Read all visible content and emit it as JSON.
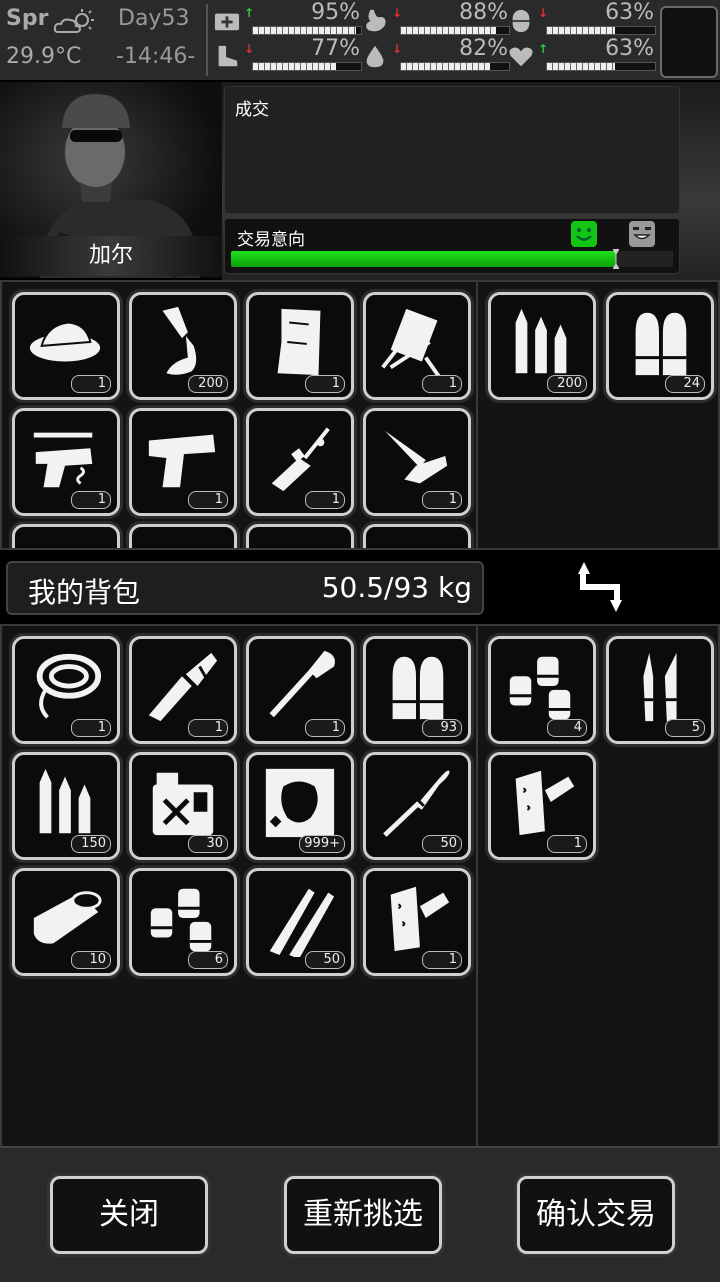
{
  "status": {
    "season": "Spr",
    "temperature": "29.9°C",
    "day": "Day53",
    "time": "-14:46-",
    "stats": [
      {
        "icon": "medkit-icon",
        "trend": "up",
        "value": "95%",
        "level": 0.95
      },
      {
        "icon": "stomach-icon",
        "trend": "down",
        "value": "88%",
        "level": 0.88
      },
      {
        "icon": "stamina-pill-icon",
        "trend": "down",
        "value": "63%",
        "level": 0.63
      },
      {
        "icon": "boot-icon",
        "trend": "down",
        "value": "77%",
        "level": 0.77
      },
      {
        "icon": "water-drop-icon",
        "trend": "down",
        "value": "82%",
        "level": 0.82
      },
      {
        "icon": "heart-icon",
        "trend": "up",
        "value": "63%",
        "level": 0.63
      }
    ]
  },
  "trader": {
    "name": "加尔",
    "dialog": "成交",
    "intent_label": "交易意向",
    "intent_level": 0.87
  },
  "trader_items": [
    {
      "icon": "dish-helmet-icon",
      "qty": "1"
    },
    {
      "icon": "glue-tube-icon",
      "qty": "200"
    },
    {
      "icon": "cloth-scrap-icon",
      "qty": "1"
    },
    {
      "icon": "folding-chair-icon",
      "qty": "1"
    },
    {
      "icon": "pistol-parts-icon",
      "qty": "1"
    },
    {
      "icon": "desert-eagle-icon",
      "qty": "1"
    },
    {
      "icon": "rifle-parts-icon",
      "qty": "1"
    },
    {
      "icon": "folding-knife-icon",
      "qty": "1"
    }
  ],
  "trader_offer": [
    {
      "icon": "rifle-ammo-icon",
      "qty": "200"
    },
    {
      "icon": "pistol-ammo-icon",
      "qty": "24"
    }
  ],
  "bag": {
    "title": "我的背包",
    "weight": "50.5/93 kg"
  },
  "bag_items": [
    {
      "icon": "rope-icon",
      "qty": "1"
    },
    {
      "icon": "multitool-icon",
      "qty": "1"
    },
    {
      "icon": "shovel-icon",
      "qty": "1"
    },
    {
      "icon": "pistol-ammo-icon",
      "qty": "93"
    },
    {
      "icon": "rifle-ammo-icon",
      "qty": "150"
    },
    {
      "icon": "fuel-can-icon",
      "qty": "30"
    },
    {
      "icon": "scrap-metal-icon",
      "qty": "999+"
    },
    {
      "icon": "rpg-rocket-icon",
      "qty": "50"
    },
    {
      "icon": "canned-food-icon",
      "qty": "10"
    },
    {
      "icon": "shotgun-shells-icon",
      "qty": "6"
    },
    {
      "icon": "sniper-ammo-icon",
      "qty": "50"
    },
    {
      "icon": "bandage-roll-icon",
      "qty": "1"
    }
  ],
  "my_offer": [
    {
      "icon": "shotgun-shells-icon",
      "qty": "4"
    },
    {
      "icon": "syringe-ampoule-icon",
      "qty": "5"
    },
    {
      "icon": "bandage-roll-icon",
      "qty": "1"
    }
  ],
  "buttons": {
    "close": "关闭",
    "reselect": "重新挑选",
    "confirm": "确认交易"
  },
  "colors": {
    "accent_green": "#13c613",
    "trend_up": "#2ecc40",
    "trend_down": "#e03030"
  }
}
